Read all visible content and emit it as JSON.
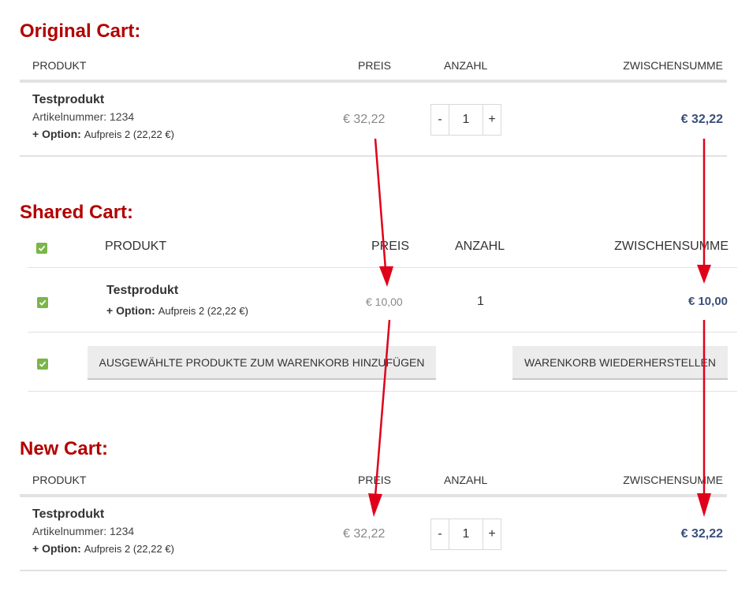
{
  "colors": {
    "title_red": "#b30000",
    "arrow_red": "#e0001a",
    "subtotal_blue": "#3a4f7a",
    "check_green": "#7ab648"
  },
  "original": {
    "title": "Original Cart:",
    "headers": {
      "product": "PRODUKT",
      "price": "PREIS",
      "qty": "ANZAHL",
      "subtotal": "ZWISCHENSUMME"
    },
    "item": {
      "name": "Testprodukt",
      "sku": "Artikelnummer: 1234",
      "option_label": "+ Option:",
      "option_value": "Aufpreis 2 (22,22 €)",
      "price": "€ 32,22",
      "qty": "1",
      "minus": "-",
      "plus": "+",
      "subtotal": "€ 32,22"
    }
  },
  "shared": {
    "title": "Shared Cart:",
    "headers": {
      "product": "PRODUKT",
      "price": "PREIS",
      "qty": "ANZAHL",
      "subtotal": "ZWISCHENSUMME"
    },
    "item": {
      "name": "Testprodukt",
      "option_label": "+ Option:",
      "option_value": "Aufpreis 2 (22,22 €)",
      "price": "€ 10,00",
      "qty": "1",
      "subtotal": "€ 10,00"
    },
    "buttons": {
      "add_selected": "AUSGEWÄHLTE PRODUKTE ZUM WARENKORB HINZUFÜGEN",
      "restore": "WARENKORB WIEDERHERSTELLEN"
    }
  },
  "new": {
    "title": "New Cart:",
    "headers": {
      "product": "PRODUKT",
      "price": "PREIS",
      "qty": "ANZAHL",
      "subtotal": "ZWISCHENSUMME"
    },
    "item": {
      "name": "Testprodukt",
      "sku": "Artikelnummer: 1234",
      "option_label": "+ Option:",
      "option_value": "Aufpreis 2 (22,22 €)",
      "price": "€ 32,22",
      "qty": "1",
      "minus": "-",
      "plus": "+",
      "subtotal": "€ 32,22"
    }
  }
}
